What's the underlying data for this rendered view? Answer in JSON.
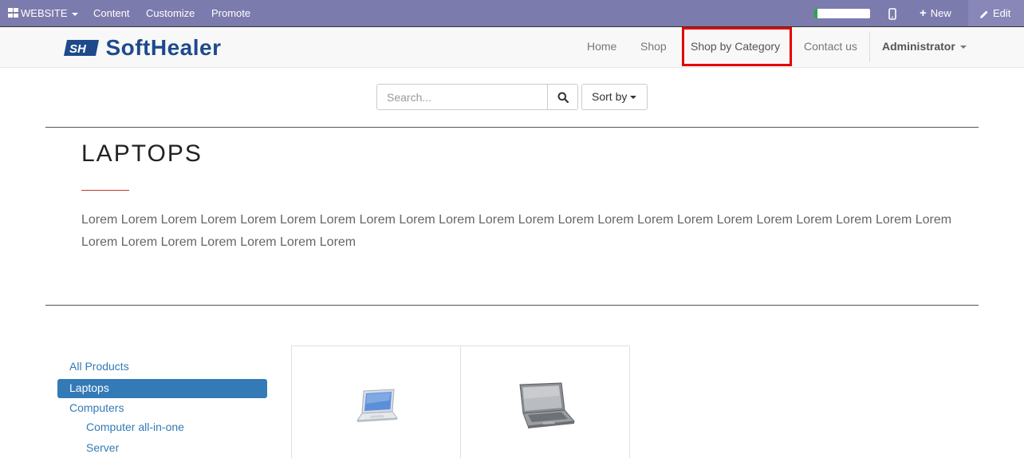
{
  "admin_bar": {
    "website_label": "WEBSITE",
    "menu": [
      "Content",
      "Customize",
      "Promote"
    ],
    "progress_fraction": 0.05,
    "new_label": "New",
    "edit_label": "Edit"
  },
  "header": {
    "logo_text": "SoftHealer",
    "nav": [
      "Home",
      "Shop",
      "Shop by Category",
      "Contact us"
    ],
    "user_label": "Administrator"
  },
  "search": {
    "placeholder": "Search...",
    "sort_label": "Sort by"
  },
  "category": {
    "title": "LAPTOPS",
    "description": "Lorem Lorem Lorem Lorem Lorem Lorem Lorem Lorem Lorem Lorem Lorem Lorem Lorem Lorem Lorem Lorem Lorem Lorem Lorem Lorem Lorem Lorem Lorem Lorem Lorem Lorem Lorem Lorem Lorem"
  },
  "sidebar": {
    "items": [
      "All Products",
      "Laptops",
      "Computers",
      "Computer all-in-one",
      "Server"
    ]
  },
  "colors": {
    "admin_bar": "#7c7bad",
    "link": "#337ab7",
    "highlight_box": "#e30000",
    "logo": "#1e4a8c"
  }
}
